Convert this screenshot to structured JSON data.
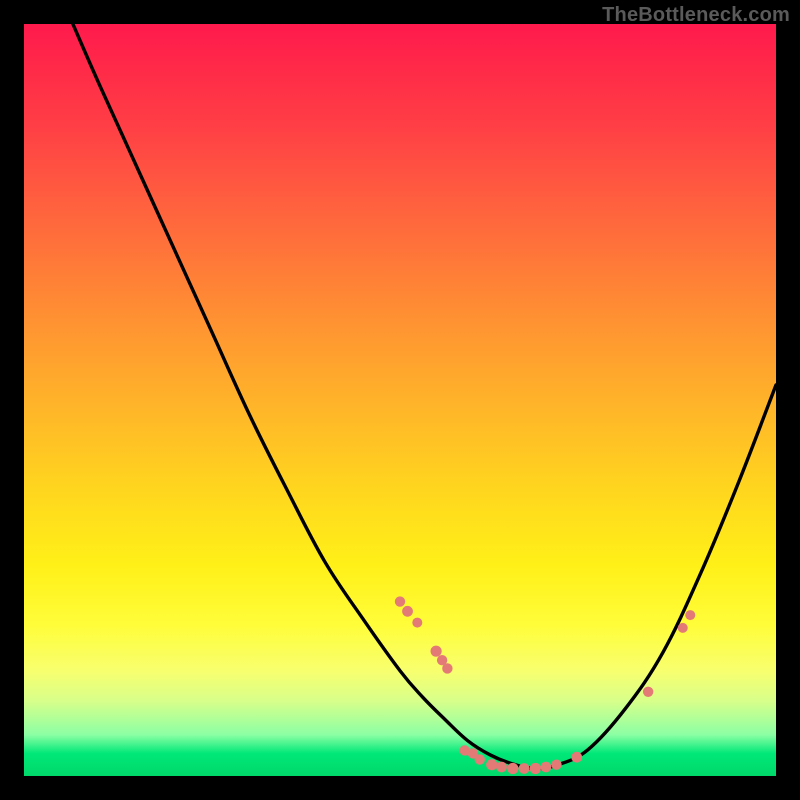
{
  "watermark": "TheBottleneck.com",
  "colors": {
    "curve": "#000000",
    "marker": "#e47a76",
    "frame_bg": "#000000"
  },
  "chart_data": {
    "type": "line",
    "title": "",
    "xlabel": "",
    "ylabel": "",
    "xlim": [
      0,
      100
    ],
    "ylim": [
      0,
      100
    ],
    "note": "x = normalized horizontal position (0 left, 100 right); y = normalized vertical position (0 top, 100 bottom). Curve is a V/check shape with rounded valley.",
    "series": [
      {
        "name": "curve",
        "x": [
          6.5,
          10,
          15,
          20,
          25,
          30,
          35,
          40,
          45,
          50,
          53,
          56,
          59,
          62,
          65,
          68,
          71,
          75,
          80,
          85,
          90,
          95,
          100
        ],
        "y": [
          0,
          8,
          19,
          30,
          41,
          52,
          62,
          71.5,
          79,
          86,
          89.5,
          92.5,
          95.3,
          97.2,
          98.4,
          99,
          98.5,
          96.5,
          91,
          83.5,
          73,
          61,
          48
        ]
      }
    ],
    "markers": {
      "comment": "Salmon dots clustered near the valley and on the right limb (approx positions read from image).",
      "points": [
        {
          "x": 50.0,
          "y": 76.8,
          "r": 5.2
        },
        {
          "x": 51.0,
          "y": 78.1,
          "r": 5.4
        },
        {
          "x": 52.3,
          "y": 79.6,
          "r": 5.0
        },
        {
          "x": 54.8,
          "y": 83.4,
          "r": 5.6
        },
        {
          "x": 55.6,
          "y": 84.6,
          "r": 5.2
        },
        {
          "x": 56.3,
          "y": 85.7,
          "r": 5.2
        },
        {
          "x": 58.6,
          "y": 96.6,
          "r": 5.2
        },
        {
          "x": 59.7,
          "y": 97.0,
          "r": 5.2
        },
        {
          "x": 60.6,
          "y": 97.8,
          "r": 5.2
        },
        {
          "x": 62.2,
          "y": 98.5,
          "r": 5.6
        },
        {
          "x": 63.5,
          "y": 98.8,
          "r": 5.4
        },
        {
          "x": 65.0,
          "y": 99.0,
          "r": 5.6
        },
        {
          "x": 66.5,
          "y": 99.0,
          "r": 5.4
        },
        {
          "x": 68.0,
          "y": 99.0,
          "r": 5.6
        },
        {
          "x": 69.4,
          "y": 98.8,
          "r": 5.4
        },
        {
          "x": 70.8,
          "y": 98.5,
          "r": 5.2
        },
        {
          "x": 73.5,
          "y": 97.5,
          "r": 5.4
        },
        {
          "x": 83.0,
          "y": 88.8,
          "r": 5.2
        },
        {
          "x": 87.6,
          "y": 80.3,
          "r": 5.0
        },
        {
          "x": 88.6,
          "y": 78.6,
          "r": 5.0
        }
      ]
    }
  }
}
